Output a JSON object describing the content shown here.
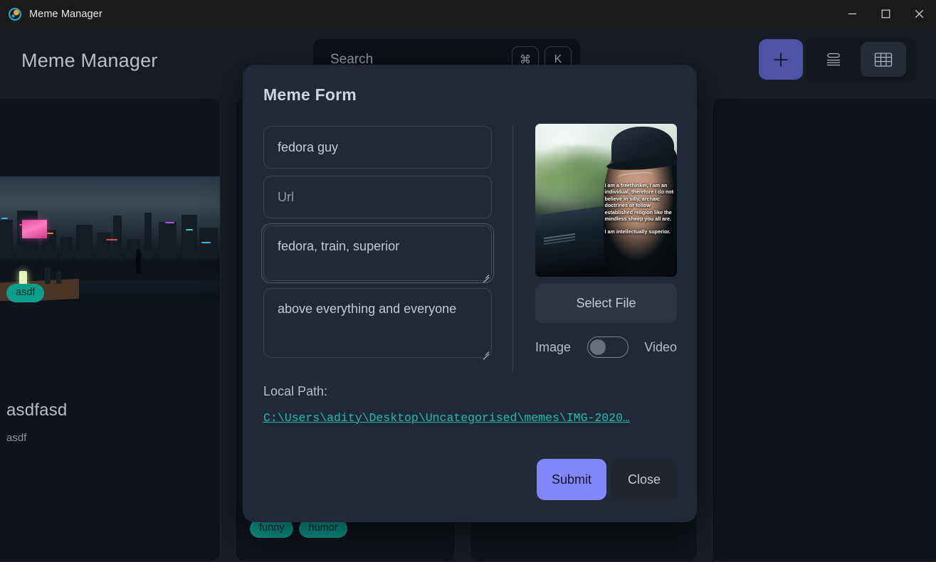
{
  "window": {
    "title": "Meme Manager",
    "logo_icon": "app-logo-icon",
    "controls": {
      "minimize": "minimize-icon",
      "maximize": "maximize-icon",
      "close": "close-icon"
    }
  },
  "header": {
    "app_title": "Meme Manager",
    "search": {
      "placeholder": "Search",
      "shortcut_modifier": "⌘",
      "shortcut_key": "K"
    },
    "add_button_label": "+",
    "view_toggle": {
      "list_label": "list-view",
      "grid_label": "grid-view",
      "active": "grid-view"
    }
  },
  "cards": [
    {
      "title": "asdfasd",
      "description": "asdf",
      "tags": [
        "asdf"
      ]
    },
    {
      "title": "",
      "description": "",
      "tags": [
        "funny",
        "humor"
      ]
    }
  ],
  "modal": {
    "title": "Meme Form",
    "fields": {
      "name_value": "fedora guy",
      "url_placeholder": "Url",
      "tags_value": "fedora, train, superior",
      "description_value": "above everything and everyone"
    },
    "preview": {
      "caption_part1": "I am a freethinker, I am an individual, therefore I do not believe in silly, archaic doctrines or follow established religion like the mindless sheep you all are.",
      "caption_part2": "I am intellectually superior."
    },
    "select_file_label": "Select File",
    "media_toggle": {
      "left_label": "Image",
      "right_label": "Video",
      "selected": "Image"
    },
    "local_path_label": "Local Path:",
    "local_path_value": "C:\\Users\\adity\\Desktop\\Uncategorised\\memes\\IMG-2020…",
    "submit_label": "Submit",
    "close_label": "Close"
  },
  "colors": {
    "accent_purple": "#8186fa",
    "add_button_purple": "#4e53a8",
    "tag_teal": "#0f9d8e",
    "link_teal": "#1bbfae",
    "modal_bg": "#212936",
    "app_bg": "#171b23",
    "titlebar_bg": "#1b1b1b"
  }
}
